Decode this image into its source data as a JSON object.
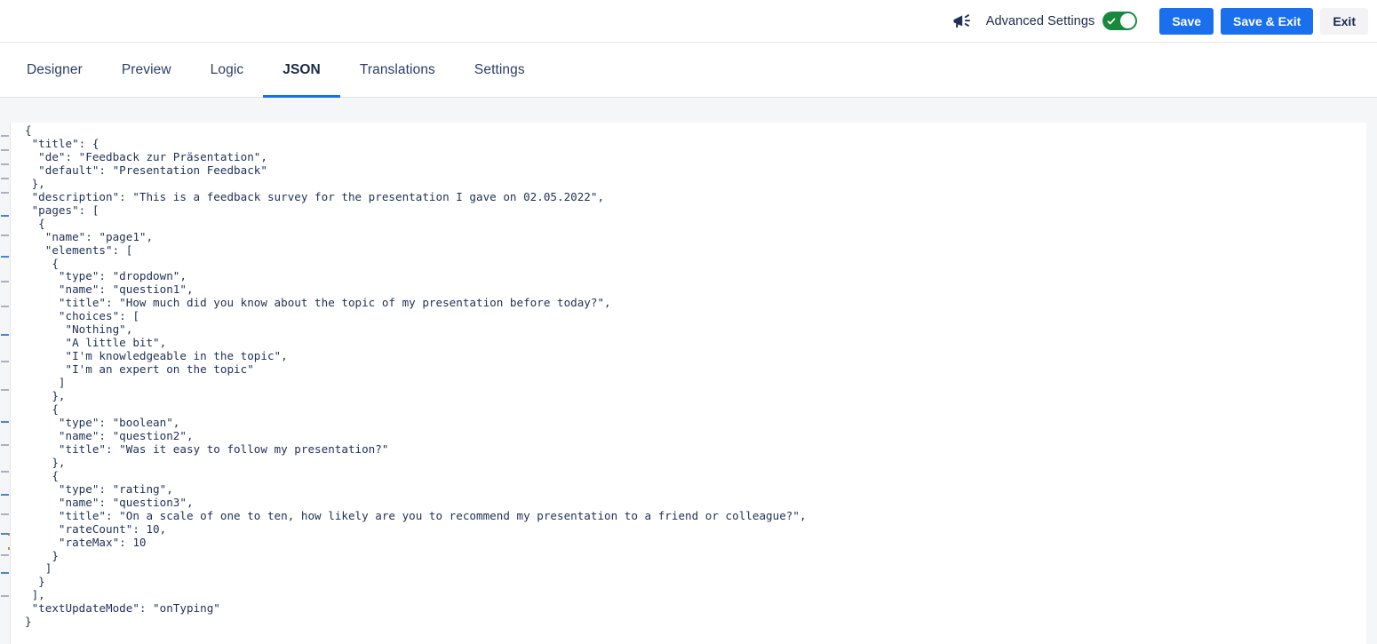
{
  "topbar": {
    "megaphone_icon": "megaphone-icon",
    "advanced_settings_label": "Advanced Settings",
    "advanced_settings_on": true,
    "toggle_check_icon": "check-icon",
    "buttons": {
      "save": "Save",
      "save_and_exit": "Save & Exit",
      "exit": "Exit"
    },
    "colors": {
      "primary_button": "#1a6fec",
      "secondary_button": "#f3f3f5",
      "toggle_on": "#19883f",
      "text": "#19294a"
    }
  },
  "tabs": {
    "active": "JSON",
    "items": [
      {
        "label": "Designer"
      },
      {
        "label": "Preview"
      },
      {
        "label": "Logic"
      },
      {
        "label": "JSON"
      },
      {
        "label": "Translations"
      },
      {
        "label": "Settings"
      }
    ],
    "accent_color": "#1a6fec"
  },
  "editor": {
    "language": "json",
    "content": "{\n \"title\": {\n  \"de\": \"Feedback zur Präsentation\",\n  \"default\": \"Presentation Feedback\"\n },\n \"description\": \"This is a feedback survey for the presentation I gave on 02.05.2022\",\n \"pages\": [\n  {\n   \"name\": \"page1\",\n   \"elements\": [\n    {\n     \"type\": \"dropdown\",\n     \"name\": \"question1\",\n     \"title\": \"How much did you know about the topic of my presentation before today?\",\n     \"choices\": [\n      \"Nothing\",\n      \"A little bit\",\n      \"I'm knowledgeable in the topic\",\n      \"I'm an expert on the topic\"\n     ]\n    },\n    {\n     \"type\": \"boolean\",\n     \"name\": \"question2\",\n     \"title\": \"Was it easy to follow my presentation?\"\n    },\n    {\n     \"type\": \"rating\",\n     \"name\": \"question3\",\n     \"title\": \"On a scale of one to ten, how likely are you to recommend my presentation to a friend or colleague?\",\n     \"rateCount\": 10,\n     \"rateMax\": 10\n    }\n   ]\n  }\n ],\n \"textUpdateMode\": \"onTyping\"\n}",
    "survey": {
      "title": {
        "de": "Feedback zur Präsentation",
        "default": "Presentation Feedback"
      },
      "description": "This is a feedback survey for the presentation I gave on 02.05.2022",
      "pages": [
        {
          "name": "page1",
          "elements": [
            {
              "type": "dropdown",
              "name": "question1",
              "title": "How much did you know about the topic of my presentation before today?",
              "choices": [
                "Nothing",
                "A little bit",
                "I'm knowledgeable in the topic",
                "I'm an expert on the topic"
              ]
            },
            {
              "type": "boolean",
              "name": "question2",
              "title": "Was it easy to follow my presentation?"
            },
            {
              "type": "rating",
              "name": "question3",
              "title": "On a scale of one to ten, how likely are you to recommend my presentation to a friend or colleague?",
              "rateCount": 10,
              "rateMax": 10
            }
          ]
        }
      ],
      "textUpdateMode": "onTyping"
    }
  }
}
